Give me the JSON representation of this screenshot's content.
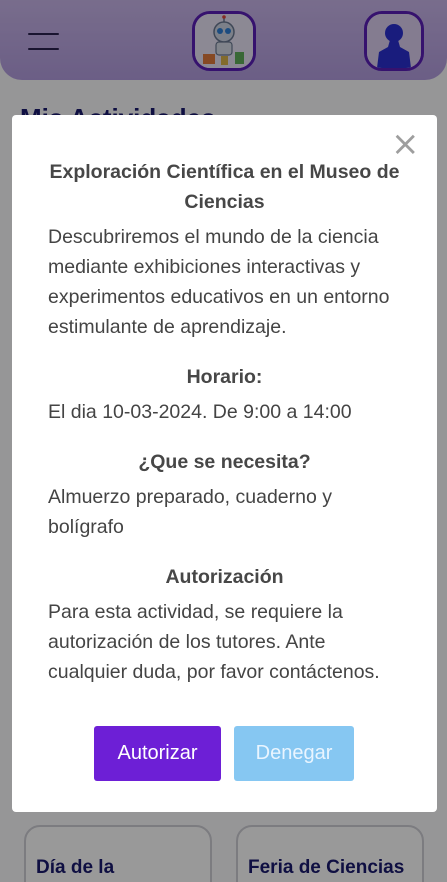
{
  "app": {
    "page_title": "Mis Actividades",
    "cards": [
      {
        "title": "Día de la"
      },
      {
        "title": "Feria de Ciencias"
      }
    ],
    "icons": {
      "menu": "hamburger-menu-icon",
      "logo": "robot-logo-icon",
      "avatar": "user-avatar-icon"
    }
  },
  "modal": {
    "close_glyph": "×",
    "title": "Exploración Científica en el Museo de Ciencias",
    "description": "Descubriremos el mundo de la ciencia mediante exhibiciones interactivas y experimentos educativos en un entorno estimulante de aprendizaje.",
    "schedule_heading": "Horario:",
    "schedule_text": "El dia 10-03-2024. De 9:00 a 14:00",
    "needs_heading": "¿Que se necesita?",
    "needs_text": "Almuerzo preparado, cuaderno y bolígrafo",
    "auth_heading": "Autorización",
    "auth_text": "Para esta actividad, se requiere la autorización de los tutores. Ante cualquier duda, por favor contáctenos.",
    "authorize_label": "Autorizar",
    "deny_label": "Denegar"
  },
  "colors": {
    "header": "#b9a3e3",
    "accent": "#6d1fd6",
    "deny": "#86c7f2",
    "title": "#1a1a6e"
  }
}
